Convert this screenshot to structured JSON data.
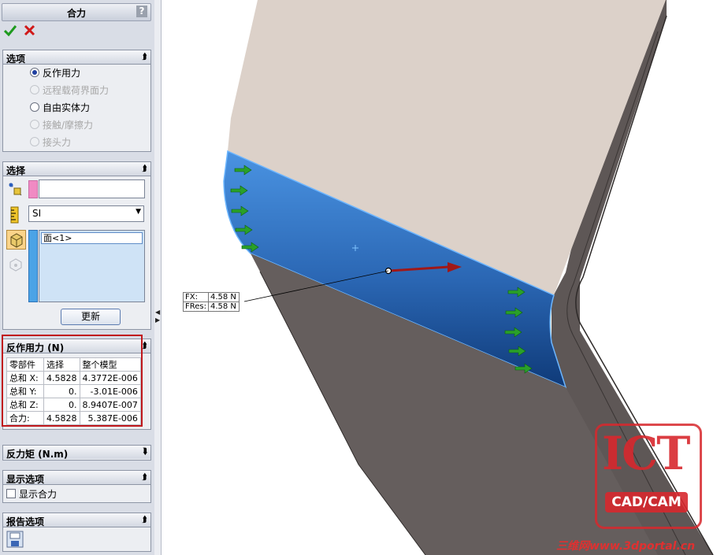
{
  "panel": {
    "title": "合力",
    "help_label": "?",
    "ok_icon": "checkmark-icon",
    "cancel_icon": "x-icon",
    "options": {
      "title": "选项",
      "radios": [
        {
          "label": "反作用力",
          "selected": true,
          "enabled": true
        },
        {
          "label": "远程载荷界面力",
          "selected": false,
          "enabled": false
        },
        {
          "label": "自由实体力",
          "selected": false,
          "enabled": true
        },
        {
          "label": "接触/摩擦力",
          "selected": false,
          "enabled": false
        },
        {
          "label": "接头力",
          "selected": false,
          "enabled": false
        }
      ]
    },
    "selection": {
      "title": "选择",
      "units_value": "SI",
      "list_item": "面<1>",
      "update_button": "更新"
    },
    "reaction_force": {
      "title": "反作用力 (N)",
      "headers": [
        "零部件",
        "选择",
        "整个模型"
      ],
      "rows": [
        [
          "总和 X:",
          "4.5828",
          "4.3772E-006"
        ],
        [
          "总和 Y:",
          "0.",
          "-3.01E-006"
        ],
        [
          "总和 Z:",
          "0.",
          "8.9407E-007"
        ],
        [
          "合力:",
          "4.5828",
          "5.387E-006"
        ]
      ]
    },
    "reaction_moment": {
      "title": "反力矩 (N.m)"
    },
    "display_options": {
      "title": "显示选项",
      "checkbox_label": "显示合力"
    },
    "report_options": {
      "title": "报告选项"
    }
  },
  "viewport": {
    "callout": [
      {
        "label": "FX:",
        "value": "4.58 N"
      },
      {
        "label": "FRes:",
        "value": "4.58 N"
      }
    ],
    "watermark": {
      "logo_text": "ICT",
      "logo_subtext": "CAD/CAM",
      "site_text": "三维网www.3dportal.cn"
    }
  },
  "colors": {
    "face_blue": "#3f86d6",
    "arrow_green": "#2aa02a",
    "resultant_red": "#a01818",
    "highlight_red": "#c0181c"
  }
}
